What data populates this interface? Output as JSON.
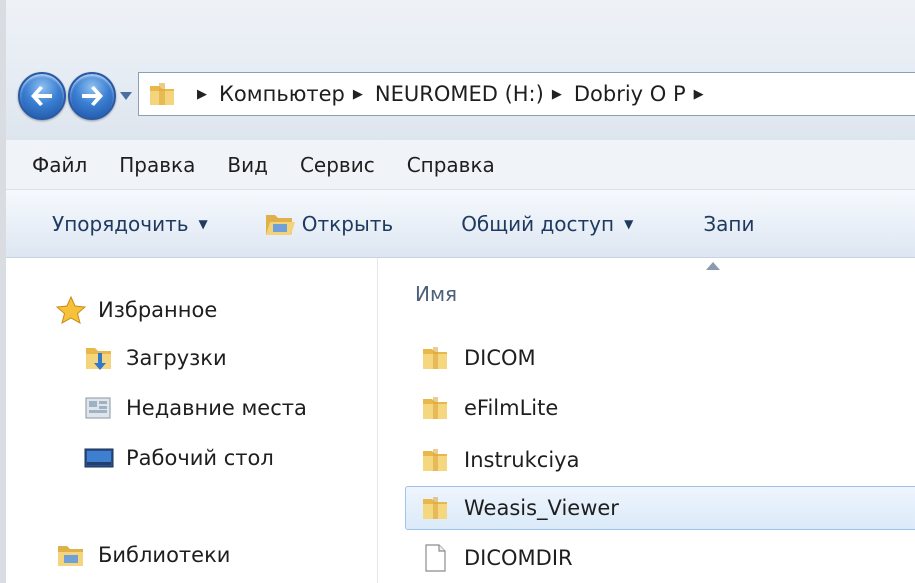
{
  "address_bar": {
    "breadcrumbs": [
      "Компьютер",
      "NEUROMED (H:)",
      "Dobriy O P"
    ]
  },
  "menu": {
    "items": [
      "Файл",
      "Правка",
      "Вид",
      "Сервис",
      "Справка"
    ]
  },
  "toolbar": {
    "organize_label": "Упорядочить",
    "open_label": "Открыть",
    "share_label": "Общий доступ",
    "burn_label": "Запи"
  },
  "nav_pane": {
    "favorites_label": "Избранное",
    "downloads_label": "Загрузки",
    "recent_label": "Недавние места",
    "desktop_label": "Рабочий стол",
    "libraries_label": "Библиотеки"
  },
  "file_list": {
    "column_name": "Имя",
    "selected_index": 3,
    "items": [
      {
        "name": "DICOM",
        "type": "folder"
      },
      {
        "name": "eFilmLite",
        "type": "folder"
      },
      {
        "name": "Instrukciya",
        "type": "folder"
      },
      {
        "name": "Weasis_Viewer",
        "type": "folder"
      },
      {
        "name": "DICOMDIR",
        "type": "file"
      }
    ]
  },
  "colors": {
    "selection": "#dbeaf9",
    "selection_border": "#9cc3ea",
    "toolbar_text": "#1e3a5f"
  }
}
